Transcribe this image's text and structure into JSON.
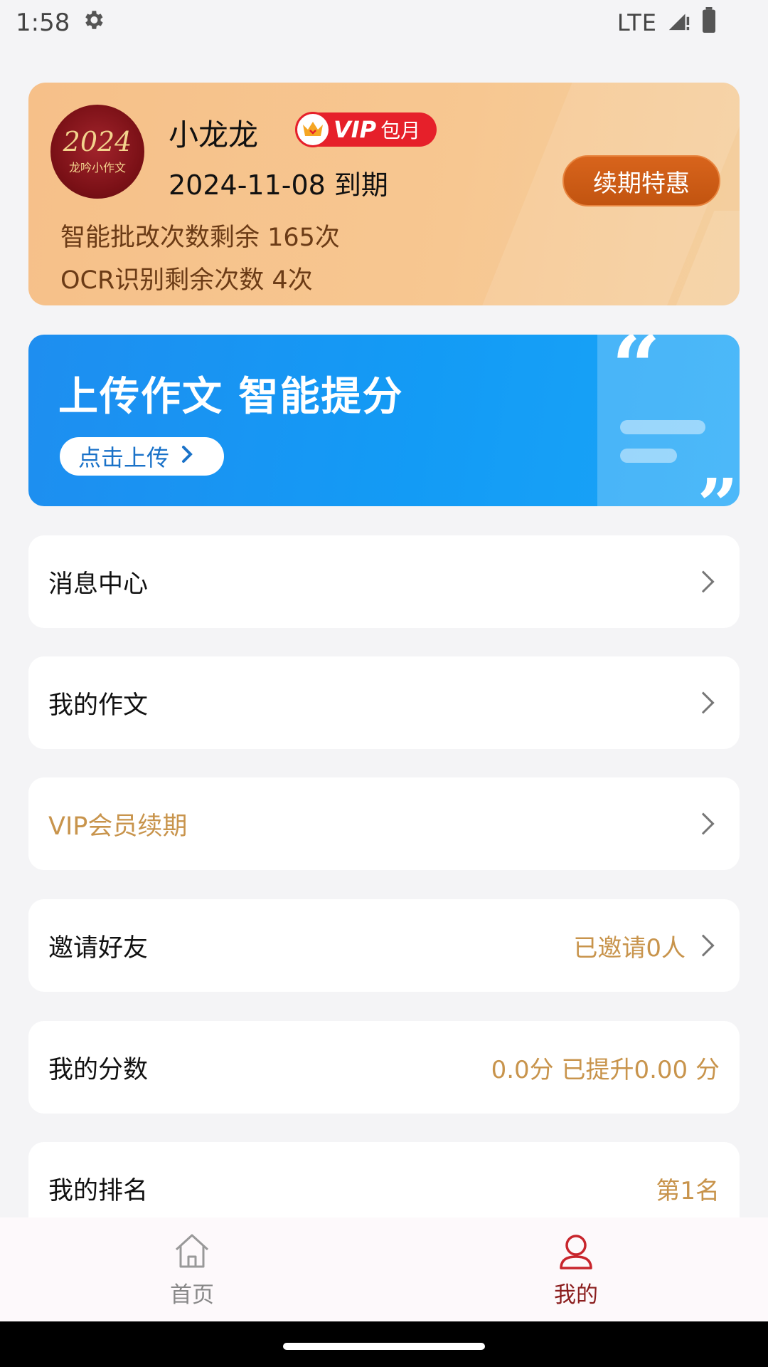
{
  "status_bar": {
    "time": "1:58",
    "network": "LTE"
  },
  "member": {
    "avatar_year": "2024",
    "avatar_text": "龙吟小作文",
    "username": "小龙龙",
    "badge_vip": "VIP",
    "badge_plan": "包月",
    "expiry": "2024-11-08 到期",
    "renew_label": "续期特惠",
    "quota_grading": "智能批改次数剩余 165次",
    "quota_ocr": "OCR识别剩余次数 4次"
  },
  "banner": {
    "slogan": "上传作文 智能提分",
    "button_label": "点击上传"
  },
  "menu": {
    "messages": "消息中心",
    "my_essays": "我的作文",
    "vip_renewal": "VIP会员续期",
    "invite": "邀请好友",
    "invite_value": "已邀请0人",
    "score": "我的分数",
    "score_value": "0.0分 已提升0.00 分",
    "rank": "我的排名",
    "rank_value": "第1名"
  },
  "bottom_nav": {
    "home": "首页",
    "mine": "我的"
  },
  "colors": {
    "accent_gold": "#c8944c",
    "nav_active": "#c8252c",
    "banner_blue": "#1e8ef0",
    "vip_red": "#e6202a"
  }
}
